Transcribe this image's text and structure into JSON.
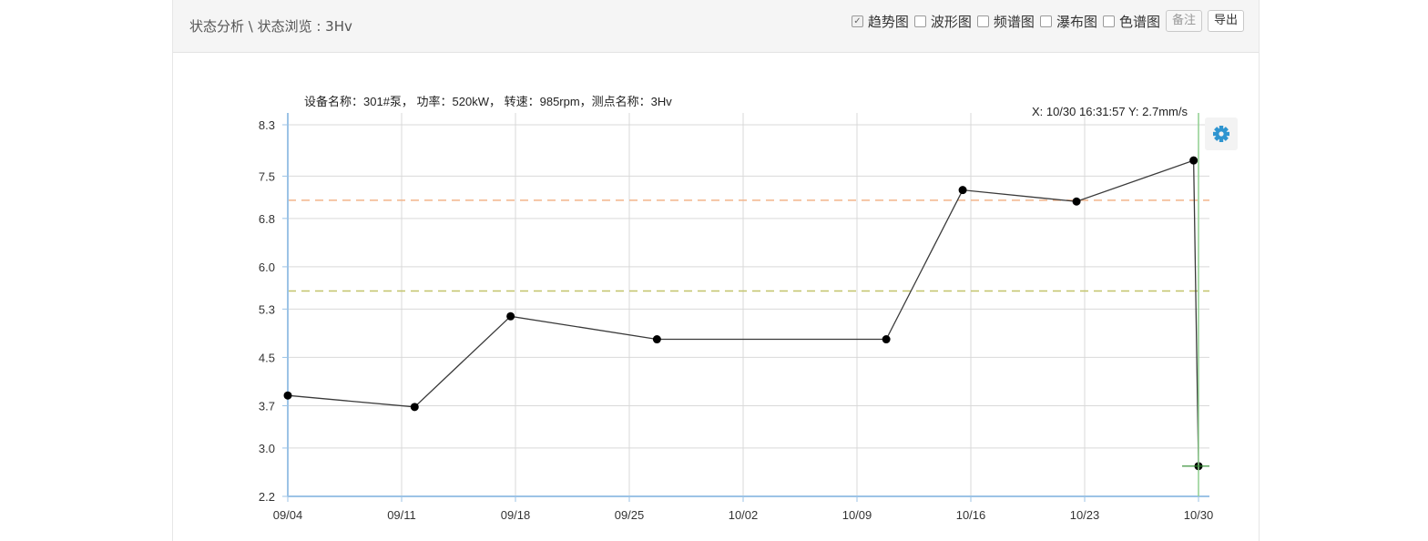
{
  "header": {
    "breadcrumb": "状态分析 \\ 状态浏览 : 3Hv",
    "options": [
      {
        "label": "趋势图",
        "checked": true
      },
      {
        "label": "波形图",
        "checked": false
      },
      {
        "label": "频谱图",
        "checked": false
      },
      {
        "label": "瀑布图",
        "checked": false
      },
      {
        "label": "色谱图",
        "checked": false
      }
    ],
    "note_button": "备注",
    "export_button": "导出"
  },
  "chart_info": "设备名称：301#泵， 功率：520kW， 转速：985rpm，测点名称：3Hv",
  "cursor_readout": "X: 10/30 16:31:57  Y: 2.7mm/s",
  "settings_icon": "gear-icon",
  "colors": {
    "line": "#3a3a3a",
    "point": "#000000",
    "axis": "#9cc3e6",
    "grid": "#d9d9d9",
    "alarm_line": "#f2b48a",
    "warning_line": "#c2c36a",
    "cursor": "#8fcf8f",
    "gear": "#2f95d0"
  },
  "chart_data": {
    "type": "line",
    "title": "",
    "xlabel": "",
    "ylabel": "",
    "x_ticks": [
      "09/04",
      "09/11",
      "09/18",
      "09/25",
      "10/02",
      "10/09",
      "10/16",
      "10/23",
      "10/30"
    ],
    "y_ticks": [
      "2.2",
      "3.0",
      "3.7",
      "4.5",
      "5.3",
      "6.0",
      "6.8",
      "7.5",
      "8.3"
    ],
    "xlim": [
      0,
      56
    ],
    "ylim": [
      2.2,
      8.35
    ],
    "series": [
      {
        "points": [
          {
            "x": 0,
            "y": 3.87
          },
          {
            "x": 7.8,
            "y": 3.68
          },
          {
            "x": 13.7,
            "y": 5.18
          },
          {
            "x": 22.7,
            "y": 4.8
          },
          {
            "x": 36.8,
            "y": 4.8
          },
          {
            "x": 41.5,
            "y": 7.27
          },
          {
            "x": 48.5,
            "y": 7.08
          },
          {
            "x": 55.7,
            "y": 7.76
          },
          {
            "x": 56.0,
            "y": 2.7
          }
        ]
      }
    ],
    "thresholds": [
      {
        "value": 7.1,
        "style": "dashed",
        "color": "#f2b48a"
      },
      {
        "value": 5.6,
        "style": "dashed",
        "color": "#c2c36a"
      }
    ],
    "cursor_x": 56.0,
    "cursor_y": 2.7,
    "grid": true,
    "legend": "none"
  }
}
